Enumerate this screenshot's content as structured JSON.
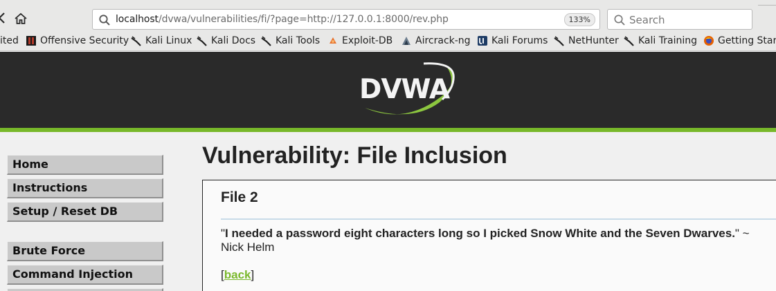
{
  "browser": {
    "url_host": "localhost",
    "url_path": "/dvwa/vulnerabilities/fi/?page=http://127.0.0.1:8000/rev.php",
    "zoom": "133%",
    "search_placeholder": "Search"
  },
  "bookmarks": [
    {
      "label": "ited"
    },
    {
      "label": "Offensive Security"
    },
    {
      "label": "Kali Linux"
    },
    {
      "label": "Kali Docs"
    },
    {
      "label": "Kali Tools"
    },
    {
      "label": "Exploit-DB"
    },
    {
      "label": "Aircrack-ng"
    },
    {
      "label": "Kali Forums"
    },
    {
      "label": "NetHunter"
    },
    {
      "label": "Kali Training"
    },
    {
      "label": "Getting Start"
    }
  ],
  "header": {
    "logo_text": "DVWA"
  },
  "menu": [
    {
      "label": "Home"
    },
    {
      "label": "Instructions"
    },
    {
      "label": "Setup / Reset DB"
    },
    {
      "label": "Brute Force"
    },
    {
      "label": "Command Injection"
    }
  ],
  "main": {
    "title": "Vulnerability: File Inclusion",
    "file_heading": "File 2",
    "quote_open": "\"",
    "quote_text": "I needed a password eight characters long so I picked Snow White and the Seven Dwarves.",
    "quote_close": "\" ~",
    "quote_author": "Nick Helm",
    "back_open": "[",
    "back_label": "back",
    "back_close": "]"
  },
  "colors": {
    "header_bg": "#2a2a2a",
    "accent_green": "#78b82a",
    "menu_bg": "#c9c9c9"
  }
}
